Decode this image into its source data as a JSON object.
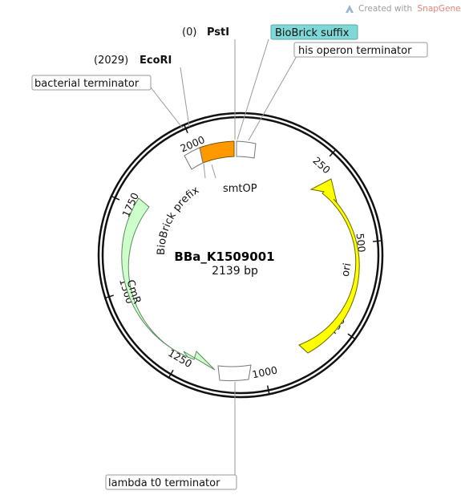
{
  "watermark": {
    "prefix": "Created with",
    "brand": "SnapGene",
    "mark": "®",
    "brand_color": "#e8837a",
    "icon": "snapgene-logo-icon"
  },
  "plasmid": {
    "name": "BBa_K1509001",
    "length_label": "2139 bp",
    "length_bp": 2139
  },
  "ticks": [
    {
      "label": "250",
      "bp": 250
    },
    {
      "label": "500",
      "bp": 500
    },
    {
      "label": "750",
      "bp": 750
    },
    {
      "label": "1000",
      "bp": 1000
    },
    {
      "label": "1250",
      "bp": 1250
    },
    {
      "label": "1500",
      "bp": 1500
    },
    {
      "label": "1750",
      "bp": 1750
    },
    {
      "label": "2000",
      "bp": 2000
    }
  ],
  "features": [
    {
      "name": "ori",
      "color": "#ffff00",
      "stroke": "#7a7a00",
      "arrow": true
    },
    {
      "name": "CmR",
      "color": "#ccffcc",
      "stroke": "#6a9a6a",
      "arrow": true
    },
    {
      "name": "smtOP",
      "color": "#ff9900",
      "stroke": "#8a5a00",
      "arrow": false
    },
    {
      "name": "BioBrick prefix",
      "color": "#ffffff",
      "stroke": "#8a8a8a",
      "arrow": false
    },
    {
      "name": "lambda t0 terminator",
      "color": "#ffffff",
      "stroke": "#8a8a8a",
      "arrow": false
    }
  ],
  "labels": {
    "pst": {
      "pos": "(0)",
      "name": "PstI"
    },
    "eco": {
      "pos": "(2029)",
      "name": "EcoRI"
    },
    "bb_suffix": {
      "text": "BioBrick suffix",
      "fill": "#7fd8d8"
    },
    "his_term": {
      "text": "his operon terminator"
    },
    "bact_term": {
      "text": "bacterial terminator"
    },
    "lambda_term": {
      "text": "lambda t0 terminator"
    },
    "smtop": {
      "text": "smtOP"
    },
    "bb_prefix": {
      "text": "BioBrick prefix"
    },
    "ori": {
      "text": "ori"
    },
    "cmr": {
      "text": "CmR"
    }
  }
}
